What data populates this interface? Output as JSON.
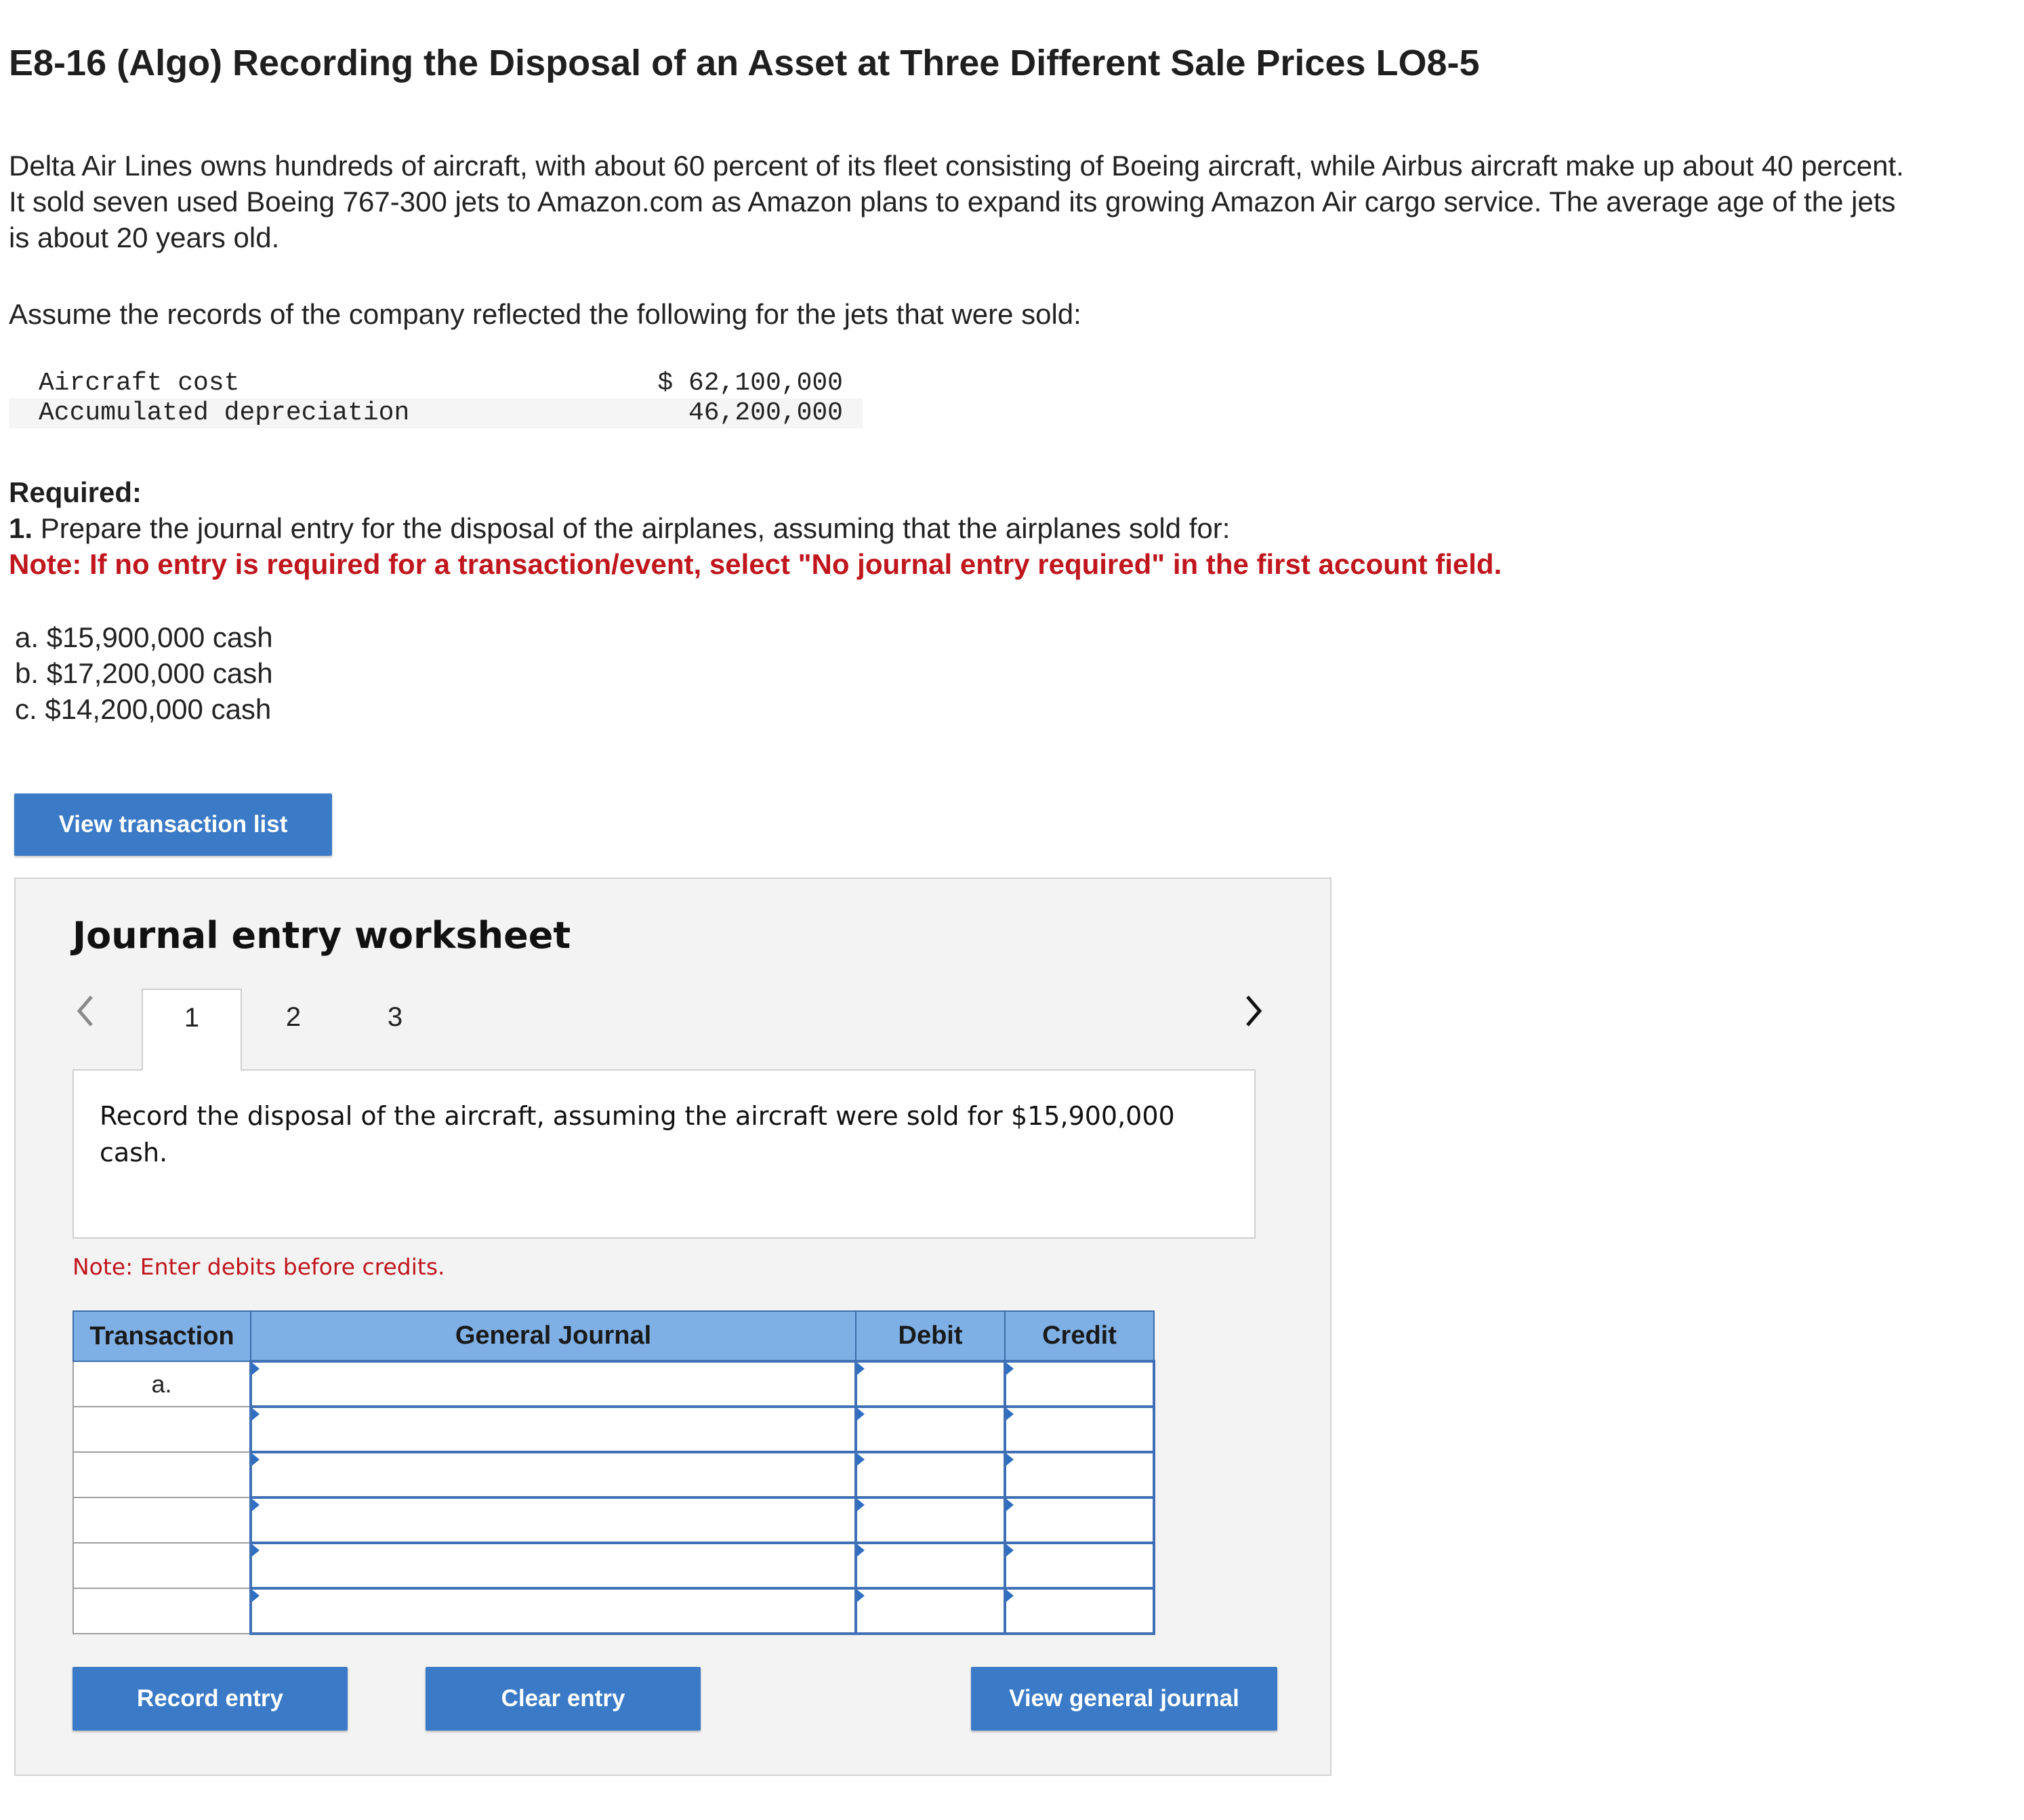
{
  "problem": {
    "title": "E8-16 (Algo) Recording the Disposal of an Asset at Three Different Sale Prices LO8-5",
    "intro": "Delta Air Lines owns hundreds of aircraft, with about 60 percent of its fleet consisting of Boeing aircraft, while Airbus aircraft make up about 40 percent. It sold seven used Boeing 767-300 jets to Amazon.com as Amazon plans to expand its growing Amazon Air cargo service. The average age of the jets is about 20 years old.",
    "assume": "Assume the records of the company reflected the following for the jets that were sold:",
    "records": [
      {
        "label": "Aircraft cost",
        "value": "$ 62,100,000"
      },
      {
        "label": "Accumulated depreciation",
        "value": "46,200,000"
      }
    ],
    "required_heading": "Required:",
    "required_number": "1.",
    "required_text": "Prepare the journal entry for the disposal of the airplanes, assuming that the airplanes sold for:",
    "note": "Note: If no entry is required for a transaction/event, select \"No journal entry required\" in the first account field.",
    "options": [
      "a. $15,900,000 cash",
      "b. $17,200,000 cash",
      "c. $14,200,000 cash"
    ]
  },
  "buttons": {
    "view_transaction_list": "View transaction list",
    "record_entry": "Record entry",
    "clear_entry": "Clear entry",
    "view_general_journal": "View general journal"
  },
  "worksheet": {
    "title": "Journal entry worksheet",
    "tabs": [
      "1",
      "2",
      "3"
    ],
    "active_tab": "1",
    "prev_icon": "chevron-left-icon",
    "next_icon": "chevron-right-icon",
    "description": "Record the disposal of the aircraft, assuming the aircraft were sold for $15,900,000 cash.",
    "debits_note": "Note: Enter debits before credits.",
    "table": {
      "headers": [
        "Transaction",
        "General Journal",
        "Debit",
        "Credit"
      ],
      "rows": [
        {
          "transaction": "a.",
          "account": "",
          "debit": "",
          "credit": ""
        },
        {
          "transaction": "",
          "account": "",
          "debit": "",
          "credit": ""
        },
        {
          "transaction": "",
          "account": "",
          "debit": "",
          "credit": ""
        },
        {
          "transaction": "",
          "account": "",
          "debit": "",
          "credit": ""
        },
        {
          "transaction": "",
          "account": "",
          "debit": "",
          "credit": ""
        },
        {
          "transaction": "",
          "account": "",
          "debit": "",
          "credit": ""
        }
      ]
    }
  },
  "colors": {
    "button": "#3a7ac6",
    "table_header": "#7eb0e6",
    "note_red": "#c0161d",
    "panel": "#f3f3f3"
  }
}
